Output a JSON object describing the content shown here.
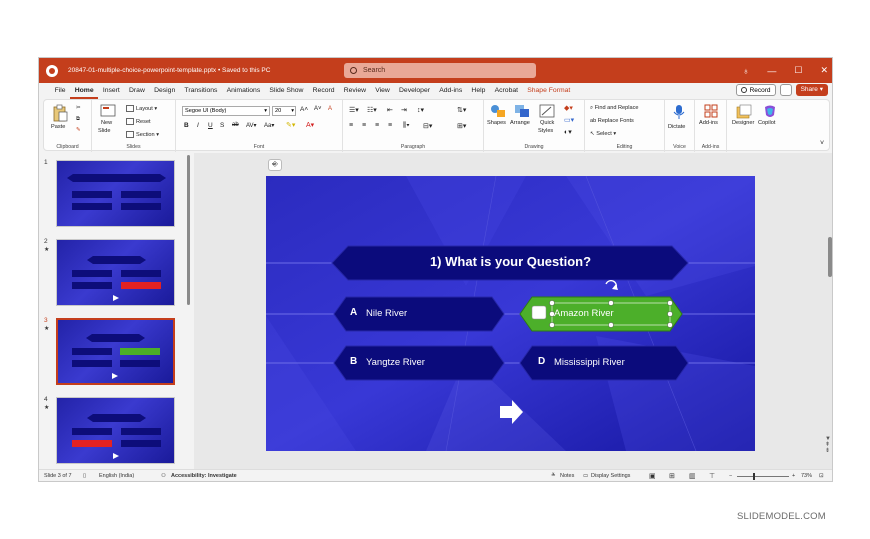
{
  "titlebar": {
    "doc_title": "20847-01-multiple-choice-powerpoint-template.pptx • Saved to this PC",
    "search_placeholder": "Search"
  },
  "menu": {
    "tabs": [
      "File",
      "Home",
      "Insert",
      "Draw",
      "Design",
      "Transitions",
      "Animations",
      "Slide Show",
      "Record",
      "Review",
      "View",
      "Developer",
      "Add-ins",
      "Help",
      "Acrobat",
      "Shape Format"
    ],
    "active_tab": "Home",
    "record_label": "Record",
    "share_label": "Share"
  },
  "ribbon": {
    "clipboard": {
      "paste": "Paste",
      "label": "Clipboard"
    },
    "slides": {
      "new_slide": "New",
      "new_slide2": "Slide",
      "layout": "Layout",
      "reset": "Reset",
      "section": "Section",
      "label": "Slides"
    },
    "font": {
      "font_name": "Segoe UI (Body)",
      "font_size": "20",
      "label": "Font"
    },
    "paragraph": {
      "label": "Paragraph"
    },
    "drawing": {
      "shapes": "Shapes",
      "arrange": "Arrange",
      "quick": "Quick",
      "styles": "Styles",
      "label": "Drawing"
    },
    "editing": {
      "find_replace": "Find and Replace",
      "replace_fonts": "Replace Fonts",
      "select": "Select",
      "label": "Editing"
    },
    "voice": {
      "dictate": "Dictate",
      "label": "Voice"
    },
    "addins": {
      "addins": "Add-ins",
      "label": "Add-ins"
    },
    "designer": "Designer",
    "copilot": "Copilot"
  },
  "thumbnails": [
    {
      "num": "1",
      "star": ""
    },
    {
      "num": "2",
      "star": "★"
    },
    {
      "num": "3",
      "star": "★"
    },
    {
      "num": "4",
      "star": "★"
    }
  ],
  "slide": {
    "question": "1) What is your Question?",
    "answers": [
      {
        "letter": "A",
        "text": "Nile River"
      },
      {
        "letter": "C",
        "text": "Amazon River"
      },
      {
        "letter": "B",
        "text": "Yangtze River"
      },
      {
        "letter": "D",
        "text": "Mississippi River"
      }
    ]
  },
  "status": {
    "slide_info": "Slide 3 of 7",
    "language": "English (India)",
    "accessibility": "Accessibility: Investigate",
    "notes": "Notes",
    "display_settings": "Display Settings",
    "zoom": "73%"
  },
  "watermark": "SLIDEMODEL.COM",
  "colors": {
    "accent": "#c43e1c",
    "slide_bg": "#1d1db2",
    "hex_dark": "#0d0d7a",
    "green": "#4caf2a"
  }
}
